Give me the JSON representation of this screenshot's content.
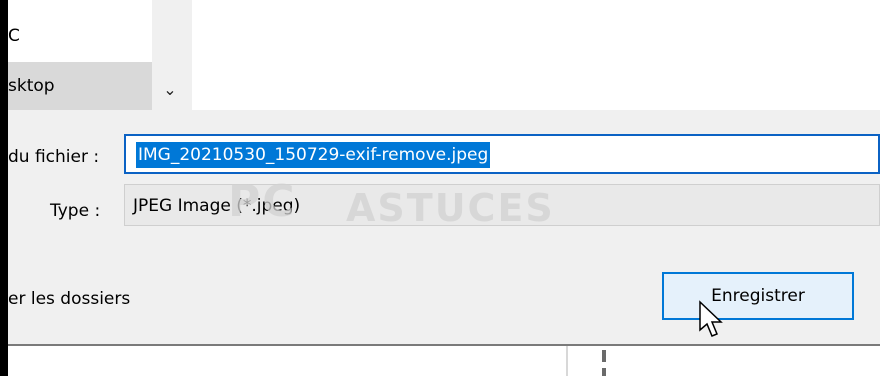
{
  "nav": {
    "items": [
      {
        "label": "C"
      },
      {
        "label": "sktop"
      }
    ],
    "chevron_icon": "chevron-down-icon"
  },
  "form": {
    "name_label": "du fichier :",
    "name_value": "IMG_20210530_150729-exif-remove.jpeg",
    "type_label": "Type :",
    "type_value": "JPEG Image (*.jpeg)"
  },
  "watermark": {
    "pc": "PC",
    "word": "ASTUCES"
  },
  "footer": {
    "hide_folders_label": "er les dossiers",
    "save_label": "Enregistrer"
  },
  "colors": {
    "selection": "#0078d7",
    "button_bg": "#e5f1fb",
    "form_bg": "#f0f0f0"
  }
}
